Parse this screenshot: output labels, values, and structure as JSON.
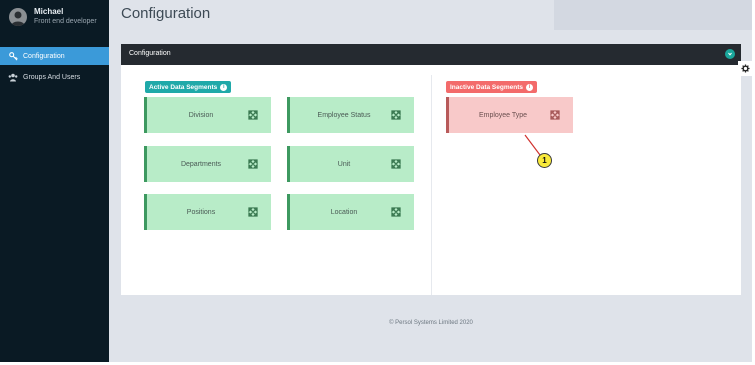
{
  "user": {
    "name": "Michael",
    "role": "Front end developer"
  },
  "nav": {
    "items": [
      {
        "label": "Configuration",
        "icon": "key-icon",
        "active": true
      },
      {
        "label": "Groups And Users",
        "icon": "users-icon",
        "active": false
      }
    ]
  },
  "page": {
    "title": "Configuration"
  },
  "panel": {
    "title": "Configuration"
  },
  "active_segments": {
    "label": "Active Data Segments",
    "info": "i",
    "items": [
      "Division",
      "Employee Status",
      "Departments",
      "Unit",
      "Positions",
      "Location"
    ]
  },
  "inactive_segments": {
    "label": "Inactive Data Segments",
    "info": "i",
    "items": [
      "Employee Type"
    ]
  },
  "callout": {
    "number": "1"
  },
  "footer": {
    "text": "© Persol Systems Limited 2020"
  },
  "colors": {
    "sidebar_bg": "#0a1a24",
    "nav_active": "#3b9ad9",
    "panel_header": "#252a30",
    "active_label": "#1fa9a9",
    "inactive_label": "#f36b6b",
    "active_card": "#b8ecc8",
    "inactive_card": "#f8c9c9",
    "callout": "#f9ea3b"
  }
}
